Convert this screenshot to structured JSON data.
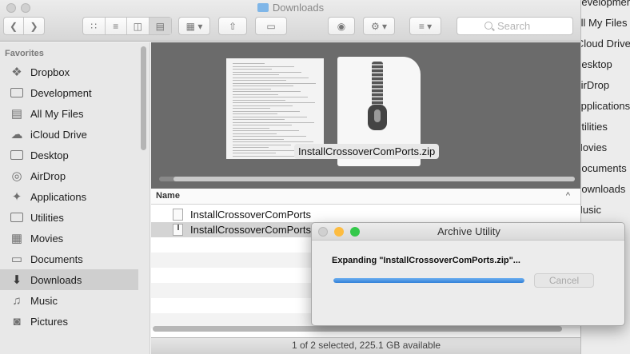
{
  "window": {
    "title": "Downloads"
  },
  "toolbar": {
    "search_placeholder": "Search"
  },
  "sidebar": {
    "header": "Favorites",
    "items": [
      {
        "label": "Dropbox",
        "icon": "dropbox-icon",
        "glyph": "❖"
      },
      {
        "label": "Development",
        "icon": "folder-icon",
        "glyph": ""
      },
      {
        "label": "All My Files",
        "icon": "all-files-icon",
        "glyph": "▤"
      },
      {
        "label": "iCloud Drive",
        "icon": "cloud-icon",
        "glyph": "☁"
      },
      {
        "label": "Desktop",
        "icon": "desktop-icon",
        "glyph": ""
      },
      {
        "label": "AirDrop",
        "icon": "airdrop-icon",
        "glyph": "◎"
      },
      {
        "label": "Applications",
        "icon": "applications-icon",
        "glyph": "✦"
      },
      {
        "label": "Utilities",
        "icon": "folder-icon",
        "glyph": ""
      },
      {
        "label": "Movies",
        "icon": "movies-icon",
        "glyph": "▦"
      },
      {
        "label": "Documents",
        "icon": "documents-icon",
        "glyph": "▭"
      },
      {
        "label": "Downloads",
        "icon": "downloads-icon",
        "glyph": "⬇",
        "selected": true
      },
      {
        "label": "Music",
        "icon": "music-icon",
        "glyph": "♫"
      },
      {
        "label": "Pictures",
        "icon": "camera-icon",
        "glyph": "◙"
      }
    ]
  },
  "preview": {
    "filename": "InstallCrossoverComPorts.zip"
  },
  "list": {
    "column_name": "Name",
    "sort_caret": "^",
    "rows": [
      {
        "name": "InstallCrossoverComPorts",
        "selected": false
      },
      {
        "name": "InstallCrossoverComPorts.zip",
        "selected": true
      }
    ]
  },
  "status": {
    "text": "1 of 2 selected, 225.1 GB available"
  },
  "archive_utility": {
    "title": "Archive Utility",
    "message": "Expanding \"InstallCrossoverComPorts.zip\"...",
    "progress": 1.0,
    "cancel_label": "Cancel"
  },
  "background_window": {
    "items": [
      "Development",
      "All My Files",
      "iCloud Drive",
      "Desktop",
      "AirDrop",
      "Applications",
      "Utilities",
      "Movies",
      "Documents",
      "Downloads",
      "Music"
    ]
  },
  "colors": {
    "close": "#fc605c",
    "minimize": "#fdbc40",
    "zoom": "#34c84a",
    "progress": "#2f7fd8"
  }
}
